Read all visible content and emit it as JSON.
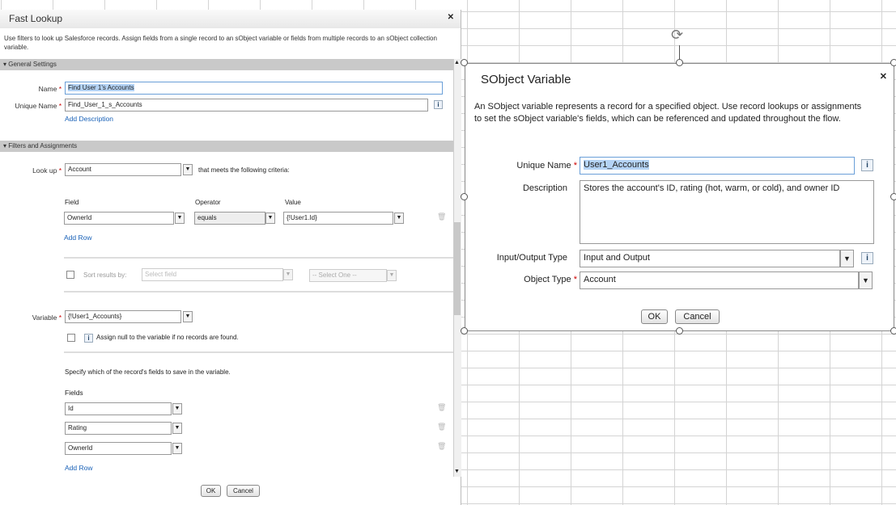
{
  "fast_lookup": {
    "title": "Fast Lookup",
    "description": "Use filters to look up Salesforce records. Assign fields from a single record to an sObject variable or fields from multiple records to an sObject collection variable.",
    "general_settings": "General Settings",
    "name_label": "Name",
    "name_value": "Find User 1's Accounts",
    "unique_name_label": "Unique Name",
    "unique_name_value": "Find_User_1_s_Accounts",
    "add_description": "Add Description",
    "filters_section": "Filters and Assignments",
    "lookup_label": "Look up",
    "lookup_value": "Account",
    "criteria_text": "that meets the following criteria:",
    "col_field": "Field",
    "col_operator": "Operator",
    "col_value": "Value",
    "filter_row": {
      "field": "OwnerId",
      "operator": "equals",
      "value": "{!User1.Id}"
    },
    "add_row": "Add Row",
    "sort_label": "Sort results by:",
    "sort_field_placeholder": "Select field",
    "sort_order_placeholder": "-- Select One --",
    "variable_label": "Variable",
    "variable_value": "{!User1_Accounts}",
    "assign_null": "Assign null to the variable if no records are found.",
    "fields_instruction": "Specify which of the record's fields to save in the variable.",
    "fields_label": "Fields",
    "fields": [
      "Id",
      "Rating",
      "OwnerId"
    ],
    "add_row2": "Add Row",
    "ok": "OK",
    "cancel": "Cancel"
  },
  "sobject_variable": {
    "title": "SObject Variable",
    "description": "An SObject variable represents a record for a specified object. Use record lookups or assignments to set the sObject variable's fields, which can be referenced and updated throughout the flow.",
    "unique_name_label": "Unique Name",
    "unique_name_value": "User1_Accounts",
    "description_label": "Description",
    "description_value": "Stores the account's ID, rating (hot, warm, or cold), and owner ID",
    "io_type_label": "Input/Output Type",
    "io_type_value": "Input and Output",
    "object_type_label": "Object Type",
    "object_type_value": "Account",
    "ok": "OK",
    "cancel": "Cancel"
  }
}
